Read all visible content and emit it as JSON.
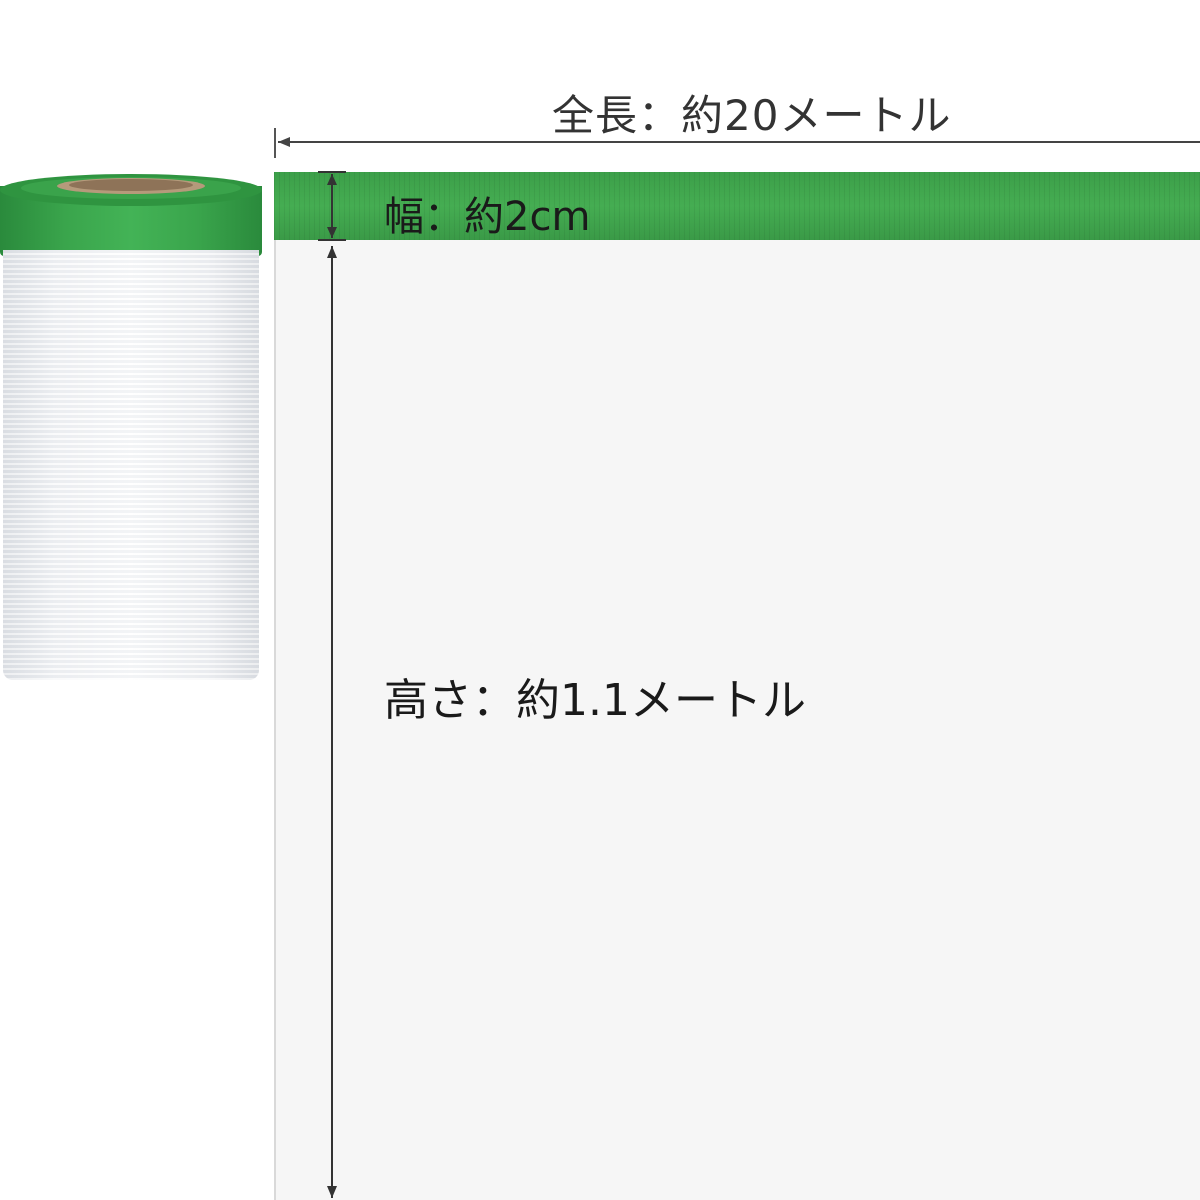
{
  "labels": {
    "length": "全長：約20メートル",
    "width": "幅：約2cm",
    "height": "高さ：約1.1メートル"
  },
  "colors": {
    "tape_green": "#3fa94d",
    "film_white": "#f4f5f7",
    "sheet_bg": "#f6f6f6",
    "dimension_line": "#333333"
  }
}
